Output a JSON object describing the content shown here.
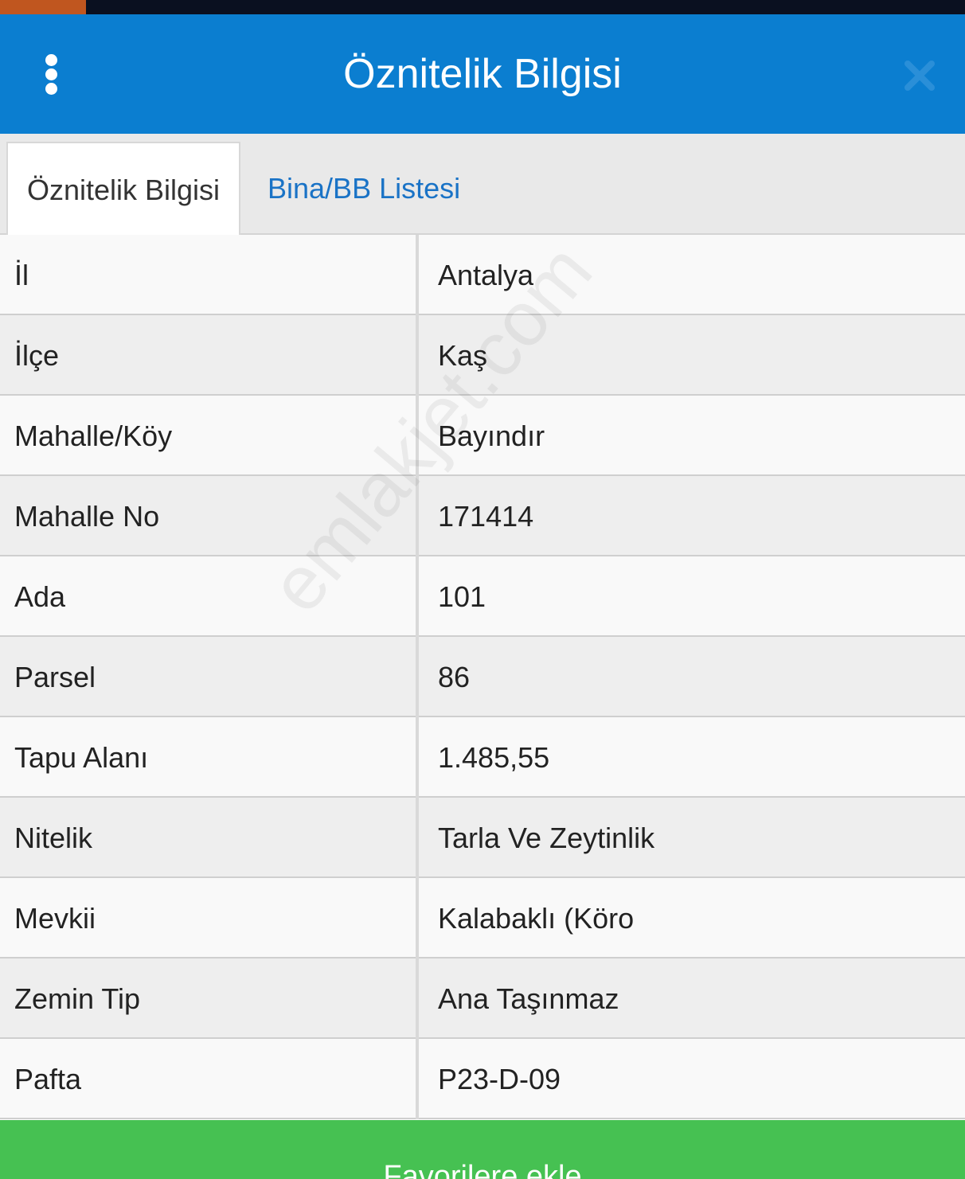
{
  "header": {
    "title": "Öznitelik Bilgisi",
    "menu_icon": "more-vertical-icon",
    "close_icon": "close-icon",
    "color": "#0b7ed0"
  },
  "tabs": [
    {
      "label": "Öznitelik Bilgisi",
      "active": true
    },
    {
      "label": "Bina/BB Listesi",
      "active": false
    }
  ],
  "attributes": [
    {
      "label": "İl",
      "value": "Antalya"
    },
    {
      "label": "İlçe",
      "value": "Kaş"
    },
    {
      "label": "Mahalle/Köy",
      "value": "Bayındır"
    },
    {
      "label": "Mahalle No",
      "value": "171414"
    },
    {
      "label": "Ada",
      "value": "101"
    },
    {
      "label": "Parsel",
      "value": "86"
    },
    {
      "label": "Tapu Alanı",
      "value": "1.485,55"
    },
    {
      "label": "Nitelik",
      "value": "Tarla Ve Zeytinlik"
    },
    {
      "label": "Mevkii",
      "value": "Kalabaklı (Köro"
    },
    {
      "label": "Zemin Tip",
      "value": "Ana Taşınmaz"
    },
    {
      "label": "Pafta",
      "value": "P23-D-09"
    }
  ],
  "watermark": "emlakjet.com",
  "footer": {
    "button_label": "Favorilere ekle",
    "color": "#46c152"
  }
}
